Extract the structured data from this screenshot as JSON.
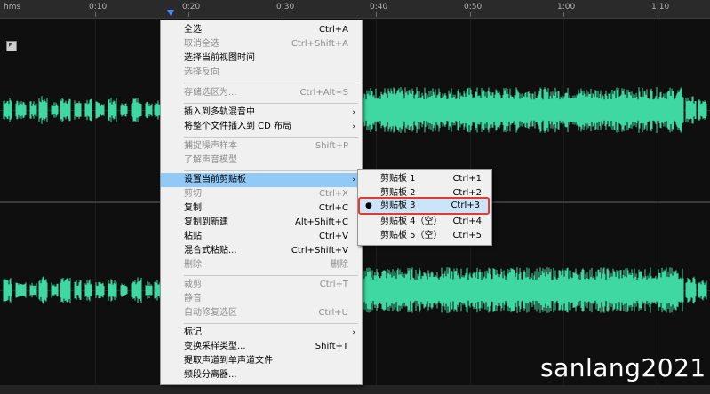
{
  "ruler": {
    "unit_label": "hms",
    "ticks": [
      "0:10",
      "0:20",
      "0:30",
      "0:40",
      "0:50",
      "1:00",
      "1:10"
    ]
  },
  "context_menu": {
    "items": [
      {
        "label": "全选",
        "shortcut": "Ctrl+A",
        "disabled": false
      },
      {
        "label": "取消全选",
        "shortcut": "Ctrl+Shift+A",
        "disabled": true
      },
      {
        "label": "选择当前视图时间",
        "shortcut": "",
        "disabled": false
      },
      {
        "label": "选择反向",
        "shortcut": "",
        "disabled": true
      },
      {
        "label": "存储选区为...",
        "shortcut": "Ctrl+Alt+S",
        "disabled": true
      },
      {
        "label": "插入到多轨混音中",
        "shortcut": "",
        "disabled": false,
        "submenu": true
      },
      {
        "label": "将整个文件插入到 CD 布局",
        "shortcut": "",
        "disabled": false,
        "submenu": true
      },
      {
        "label": "捕捉噪声样本",
        "shortcut": "Shift+P",
        "disabled": true
      },
      {
        "label": "了解声音模型",
        "shortcut": "",
        "disabled": true
      },
      {
        "label": "设置当前剪贴板",
        "shortcut": "",
        "disabled": false,
        "submenu": true,
        "highlighted": true
      },
      {
        "label": "剪切",
        "shortcut": "Ctrl+X",
        "disabled": true
      },
      {
        "label": "复制",
        "shortcut": "Ctrl+C",
        "disabled": false
      },
      {
        "label": "复制到新建",
        "shortcut": "Alt+Shift+C",
        "disabled": false
      },
      {
        "label": "粘贴",
        "shortcut": "Ctrl+V",
        "disabled": false
      },
      {
        "label": "混合式粘贴...",
        "shortcut": "Ctrl+Shift+V",
        "disabled": false
      },
      {
        "label": "删除",
        "shortcut": "删除",
        "disabled": true
      },
      {
        "label": "裁剪",
        "shortcut": "Ctrl+T",
        "disabled": true
      },
      {
        "label": "静音",
        "shortcut": "",
        "disabled": true
      },
      {
        "label": "自动修复选区",
        "shortcut": "Ctrl+U",
        "disabled": true
      },
      {
        "label": "标记",
        "shortcut": "",
        "disabled": false,
        "submenu": true
      },
      {
        "label": "变换采样类型...",
        "shortcut": "Shift+T",
        "disabled": false
      },
      {
        "label": "提取声道到单声道文件",
        "shortcut": "",
        "disabled": false
      },
      {
        "label": "频段分离器...",
        "shortcut": "",
        "disabled": false
      }
    ]
  },
  "clipboard_submenu": {
    "items": [
      {
        "label": "剪贴板 1",
        "shortcut": "Ctrl+1",
        "selected": false
      },
      {
        "label": "剪贴板 2",
        "shortcut": "Ctrl+2",
        "selected": false
      },
      {
        "label": "剪贴板 3",
        "shortcut": "Ctrl+3",
        "selected": true
      },
      {
        "label": "剪贴板 4（空）",
        "shortcut": "Ctrl+4",
        "selected": false
      },
      {
        "label": "剪贴板 5（空）",
        "shortcut": "Ctrl+5",
        "selected": false
      }
    ],
    "selected_marker": "●"
  },
  "watermark": "sanlang2021",
  "colors": {
    "waveform": "#3fd8a2",
    "menu_bg": "#f0f0f0",
    "menu_highlight": "#91c9f7",
    "active_outline": "#e53b2c",
    "playhead": "#3d8cff"
  }
}
